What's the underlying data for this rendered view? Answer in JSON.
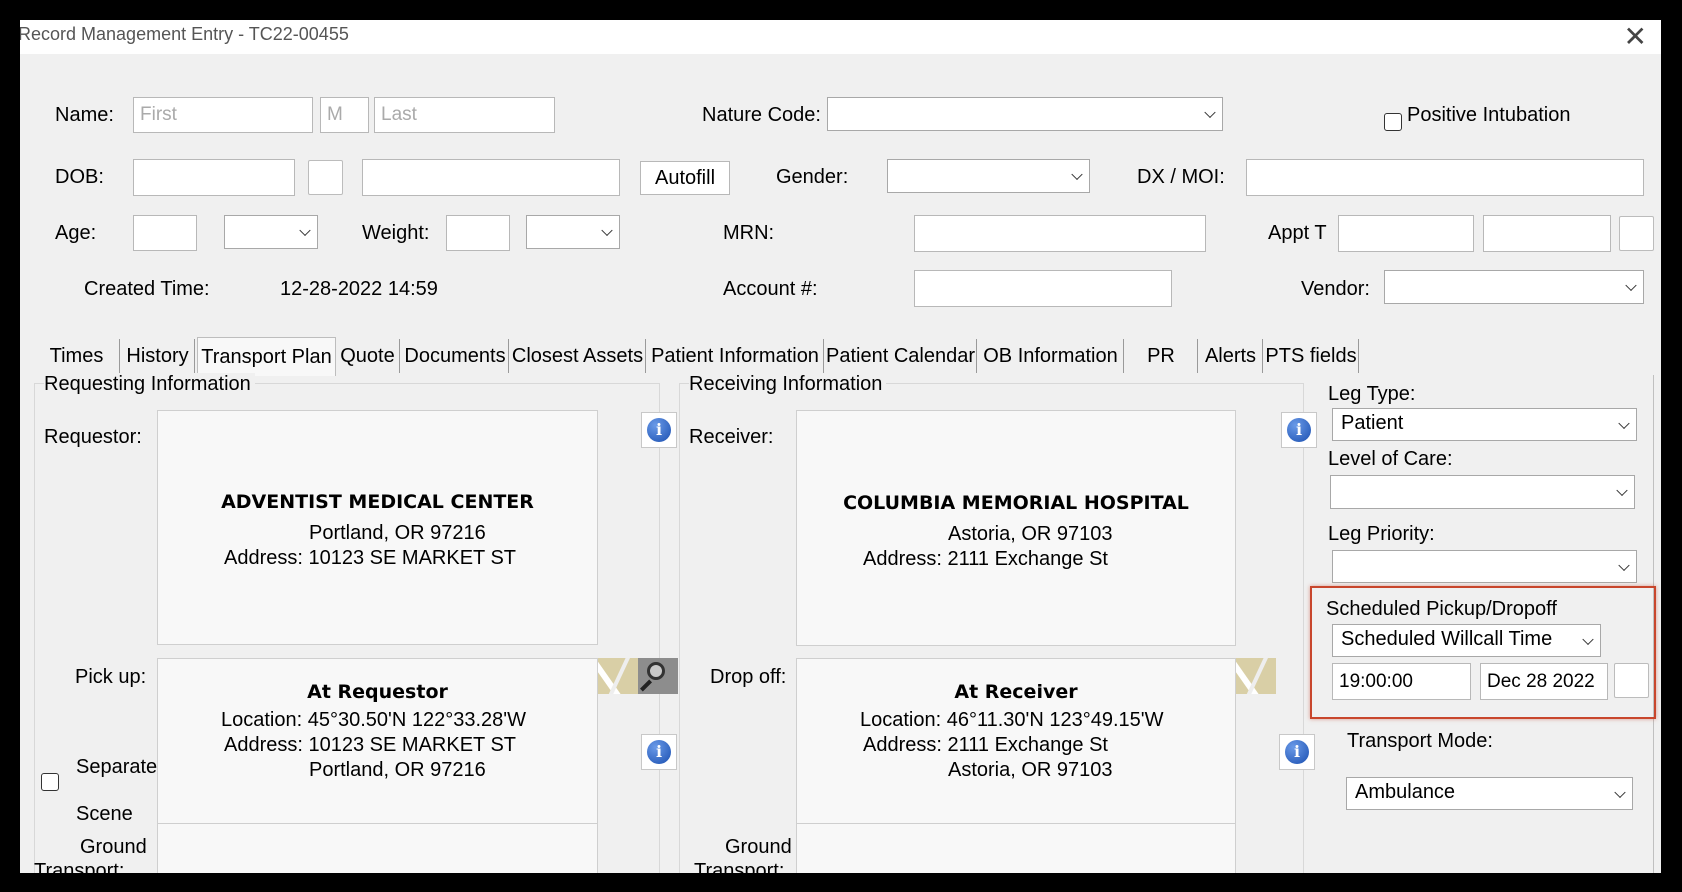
{
  "window": {
    "title": "Record Management Entry - TC22-00455",
    "close": "✕"
  },
  "header": {
    "name_label": "Name:",
    "first_placeholder": "First",
    "middle_placeholder": "M",
    "last_placeholder": "Last",
    "nature_code_label": "Nature Code:",
    "nature_code_value": "",
    "positive_intubation_label": "Positive Intubation",
    "dob_label": "DOB:",
    "autofill_label": "Autofill",
    "gender_label": "Gender:",
    "gender_value": "",
    "dx_moi_label": "DX / MOI:",
    "age_label": "Age:",
    "weight_label": "Weight:",
    "mrn_label": "MRN:",
    "appt_label": "Appt T",
    "created_time_label": "Created Time:",
    "created_time_value": "12-28-2022 14:59",
    "account_label": "Account #:",
    "vendor_label": "Vendor:",
    "vendor_value": ""
  },
  "tabs": [
    {
      "label": "Times"
    },
    {
      "label": "History"
    },
    {
      "label": "Transport Plan"
    },
    {
      "label": "Quote"
    },
    {
      "label": "Documents"
    },
    {
      "label": "Closest Assets"
    },
    {
      "label": "Patient Information"
    },
    {
      "label": "Patient Calendar"
    },
    {
      "label": "OB Information"
    },
    {
      "label": "PR"
    },
    {
      "label": "Alerts"
    },
    {
      "label": "PTS fields"
    }
  ],
  "requesting": {
    "group_label": "Requesting Information",
    "requestor_label": "Requestor:",
    "name": "ADVENTIST MEDICAL CENTER",
    "city": "Portland, OR 97216",
    "address_label": "Address:",
    "address": "10123 SE MARKET ST",
    "pickup_label": "Pick up:",
    "pickup_title": "At Requestor",
    "location_label": "Location:",
    "location": "45°30.50'N 122°33.28'W",
    "pickup_address": "10123 SE MARKET ST",
    "pickup_city": "Portland, OR 97216",
    "separate_label": "Separate",
    "scene_label": "Scene",
    "ground_label": "Ground",
    "transport_label": "Transport:"
  },
  "receiving": {
    "group_label": "Receiving Information",
    "receiver_label": "Receiver:",
    "name": "COLUMBIA MEMORIAL HOSPITAL",
    "city": "Astoria, OR 97103",
    "address_label": "Address:",
    "address": "2111 Exchange St",
    "dropoff_label": "Drop off:",
    "dropoff_title": "At Receiver",
    "location_label": "Location:",
    "location": "46°11.30'N 123°49.15'W",
    "dropoff_address": "2111 Exchange St",
    "dropoff_city": "Astoria, OR 97103",
    "ground_label": "Ground",
    "transport_label": "Transport:"
  },
  "leg": {
    "leg_type_label": "Leg Type:",
    "leg_type_value": "Patient",
    "level_of_care_label": "Level of Care:",
    "level_of_care_value": "",
    "leg_priority_label": "Leg Priority:",
    "leg_priority_value": "",
    "scheduled_label": "Scheduled Pickup/Dropoff",
    "scheduled_type_value": "Scheduled Willcall Time",
    "time_value": "19:00:00",
    "date_value": "Dec 28 2022",
    "transport_mode_label": "Transport Mode:",
    "transport_mode_value": "Ambulance"
  },
  "colors": {
    "highlight": "#c8462c",
    "info_icon": "#1a4fb0"
  }
}
